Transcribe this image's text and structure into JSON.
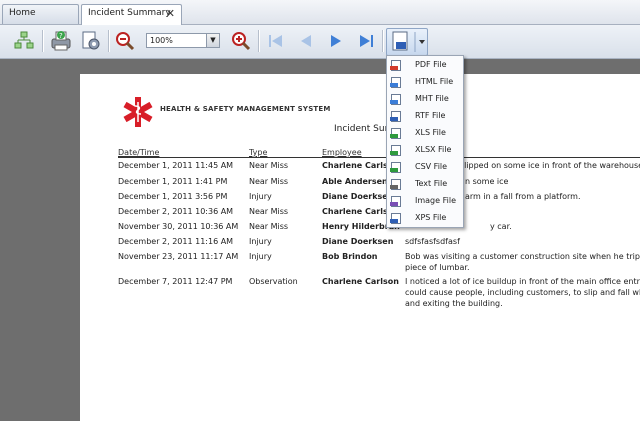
{
  "tabs": [
    {
      "label": "Home"
    },
    {
      "label": "Incident Summary"
    }
  ],
  "toolbar": {
    "zoom_value": "100%"
  },
  "report": {
    "system_title": "HEALTH & SAFETY MANAGEMENT SYSTEM",
    "title": "Incident Summ",
    "columns": [
      "Date/Time",
      "Type",
      "Employee"
    ],
    "rows": [
      {
        "date": "December 1, 2011 11:45 AM",
        "type": "Near Miss",
        "employee": "Charlene Carlson",
        "desc": "I slipped on some ice in front of the warehouse."
      },
      {
        "date": "December 1, 2011 1:41 PM",
        "type": "Near Miss",
        "employee": "Able Andersen",
        "desc": "n some ice"
      },
      {
        "date": "December 1, 2011 3:56 PM",
        "type": "Injury",
        "employee": "Diane Doerksen",
        "desc": "arm in a fall from a platform."
      },
      {
        "date": "December 2, 2011 10:36 AM",
        "type": "Near Miss",
        "employee": "Charlene Carlso",
        "desc": ""
      },
      {
        "date": "November 30, 2011 10:36 AM",
        "type": "Near Miss",
        "employee": "Henry Hilderbran",
        "desc": "y car."
      },
      {
        "date": "December 2, 2011 11:16 AM",
        "type": "Injury",
        "employee": "Diane Doerksen",
        "desc": "sdfsfasfsdfasf"
      },
      {
        "date": "November 23, 2011 11:17 AM",
        "type": "Injury",
        "employee": "Bob Brindon",
        "desc": "Bob was visiting a customer construction site when he tripped on",
        "desc2": "piece of lumbar."
      },
      {
        "date": "December 7, 2011 12:47 PM",
        "type": "Observation",
        "employee": "Charlene Carlson",
        "desc": "I noticed a lot of ice buildup in front of the main office entrance. T",
        "desc2": "could cause people, including customers, to slip and fall when ent",
        "desc3": "and exiting the building."
      }
    ]
  },
  "export_menu": [
    {
      "label": "PDF File",
      "color": "#d33b2c"
    },
    {
      "label": "HTML File",
      "color": "#3b7dd8"
    },
    {
      "label": "MHT File",
      "color": "#3b7dd8"
    },
    {
      "label": "RTF File",
      "color": "#2f5fb5"
    },
    {
      "label": "XLS File",
      "color": "#2e9a3e"
    },
    {
      "label": "XLSX File",
      "color": "#2e9a3e"
    },
    {
      "label": "CSV File",
      "color": "#2e9a3e"
    },
    {
      "label": "Text File",
      "color": "#666666"
    },
    {
      "label": "Image File",
      "color": "#7a4fb5"
    },
    {
      "label": "XPS File",
      "color": "#2f5fb5"
    }
  ]
}
